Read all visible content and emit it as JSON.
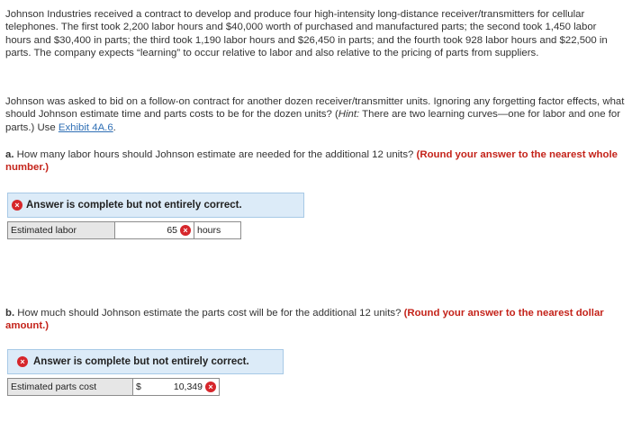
{
  "problem": {
    "paragraph1": "Johnson Industries received a contract to develop and produce four high-intensity long-distance receiver/transmitters for cellular telephones. The first took 2,200 labor hours and $40,000 worth of purchased and manufactured parts; the second took 1,450 labor hours and $30,400 in parts; the third took 1,190 labor hours and $26,450 in parts; and the fourth took 928 labor hours and $22,500 in parts. The company expects “learning” to occur relative to labor and also relative to the pricing of parts from suppliers.",
    "paragraph2_before_hint": "Johnson was asked to bid on a follow-on contract for another dozen receiver/transmitter units. Ignoring any forgetting factor effects, what should Johnson estimate time and parts costs to be for the dozen units? (",
    "hint_label": "Hint:",
    "paragraph2_after_hint": " There are two learning curves—one for labor and one for parts.) Use ",
    "exhibit_link": "Exhibit 4A.6",
    "paragraph2_end": "."
  },
  "question_a": {
    "letter": "a.",
    "text": " How many labor hours should Johnson estimate are needed for the additional 12 units? ",
    "instruction": "(Round your answer to the nearest whole number.)",
    "banner": "Answer is complete but not entirely correct.",
    "field_label": "Estimated labor",
    "value": "65",
    "unit": "hours"
  },
  "question_b": {
    "letter": "b.",
    "text": " How much should Johnson estimate the parts cost will be for the additional 12 units? ",
    "instruction": "(Round your answer to the nearest dollar amount.)",
    "banner": "Answer is complete but not entirely correct.",
    "field_label": "Estimated parts cost",
    "currency": "$",
    "value": "10,349"
  },
  "icons": {
    "incorrect": "x-circle-icon",
    "incorrect_glyph": "×"
  },
  "colors": {
    "error": "#d6262b",
    "instruction": "#c4231a",
    "banner_bg": "#dcebf8",
    "link": "#2f6fb5"
  }
}
